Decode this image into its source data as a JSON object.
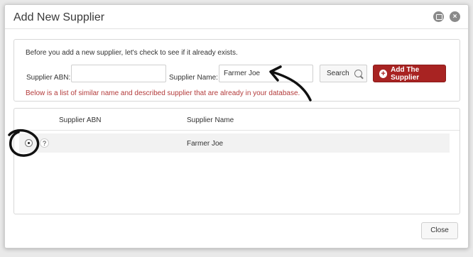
{
  "dialog": {
    "title": "Add New Supplier",
    "close_icon": "×"
  },
  "search": {
    "intro": "Before you add a new supplier, let's check to see if it already exists.",
    "abn_label": "Supplier ABN:",
    "abn_value": "",
    "name_label": "Supplier Name:",
    "name_value": "Farmer Joe",
    "search_button": "Search",
    "add_button": "Add The Supplier",
    "add_icon": "+",
    "notice": "Below is a list of similar name and described supplier that are already in your database."
  },
  "results": {
    "columns": [
      "Supplier ABN",
      "Supplier Name"
    ],
    "rows": [
      {
        "help": "?",
        "abn": "",
        "name": "Farmer Joe"
      }
    ]
  },
  "footer": {
    "close_button": "Close"
  },
  "colors": {
    "accent": "#a82322",
    "notice": "#b33b3b",
    "annotation": "#111111"
  }
}
